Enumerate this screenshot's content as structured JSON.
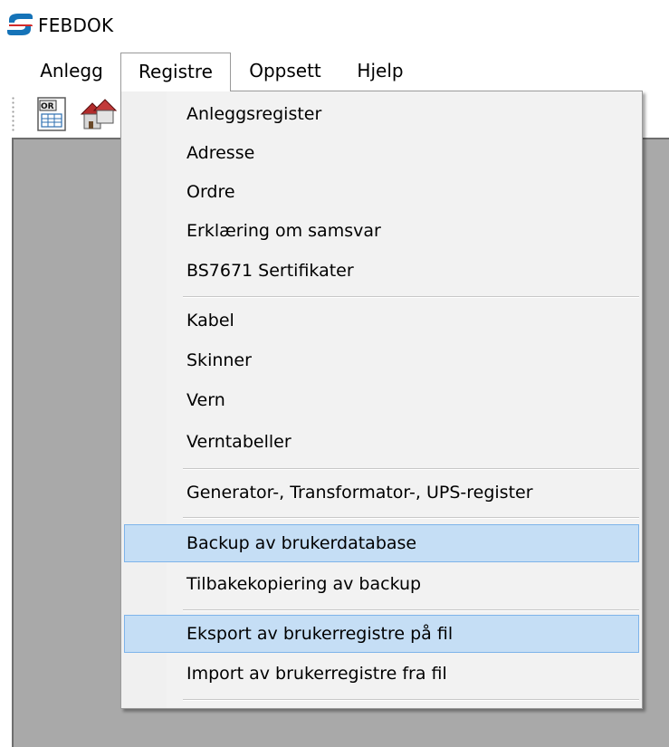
{
  "window": {
    "title": "FEBDOK",
    "icon": "febdok-logo-icon"
  },
  "colors": {
    "highlight_bg": "#c5def5",
    "highlight_border": "#7eb4ea",
    "workspace_bg": "#a9a9a9",
    "logo_blue": "#1573b8",
    "logo_red": "#d22a2a"
  },
  "menubar": {
    "items": [
      {
        "label": "Anlegg",
        "open": false
      },
      {
        "label": "Registre",
        "open": true
      },
      {
        "label": "Oppsett",
        "open": false
      },
      {
        "label": "Hjelp",
        "open": false
      }
    ]
  },
  "toolbar": {
    "buttons": [
      {
        "icon": "order-document-icon"
      },
      {
        "icon": "installation-houses-icon"
      }
    ]
  },
  "registre_menu": {
    "items": [
      {
        "label": "Anleggsregister",
        "highlighted": false
      },
      {
        "label": "Adresse",
        "highlighted": false
      },
      {
        "label": "Ordre",
        "highlighted": false
      },
      {
        "label": "Erklæring om samsvar",
        "highlighted": false
      },
      {
        "label": "BS7671 Sertifikater",
        "highlighted": false
      },
      {
        "label": "Kabel",
        "highlighted": false
      },
      {
        "label": "Skinner",
        "highlighted": false
      },
      {
        "label": "Vern",
        "highlighted": false
      },
      {
        "label": "Verntabeller",
        "highlighted": false
      },
      {
        "label": "Generator-, Transformator-, UPS-register",
        "highlighted": false
      },
      {
        "label": "Backup av brukerdatabase",
        "highlighted": true
      },
      {
        "label": "Tilbakekopiering av backup",
        "highlighted": false
      },
      {
        "label": "Eksport av brukerregistre på fil",
        "highlighted": true
      },
      {
        "label": "Import av brukerregistre fra fil",
        "highlighted": false
      }
    ]
  }
}
